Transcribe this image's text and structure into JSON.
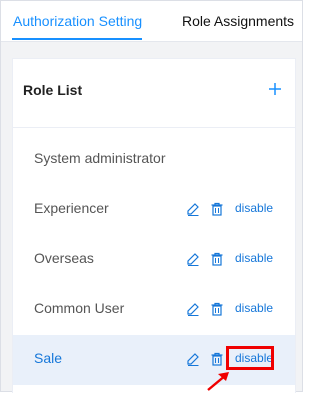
{
  "tabs": [
    {
      "label": "Authorization Setting",
      "active": true
    },
    {
      "label": "Role Assignments",
      "active": false
    }
  ],
  "role_list": {
    "title": "Role List",
    "add_icon": "plus-icon",
    "roles": [
      {
        "label": "System administrator",
        "actions": false,
        "selected": false
      },
      {
        "label": "Experiencer",
        "actions": true,
        "selected": false,
        "action_label": "disable"
      },
      {
        "label": "Overseas",
        "actions": true,
        "selected": false,
        "action_label": "disable"
      },
      {
        "label": "Common User",
        "actions": true,
        "selected": false,
        "action_label": "disable"
      },
      {
        "label": "Sale",
        "actions": true,
        "selected": true,
        "action_label": "disable"
      }
    ]
  },
  "colors": {
    "accent": "#1890ff",
    "link": "#1677d9",
    "selected_row": "#e9f0fa",
    "highlight": "#f00000"
  },
  "icons": {
    "edit": "edit-icon",
    "delete": "trash-icon",
    "annotation_arrow": "arrow-icon"
  }
}
